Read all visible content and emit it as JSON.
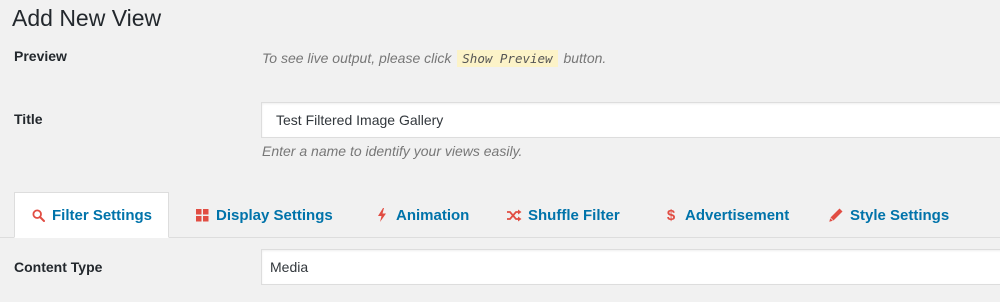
{
  "page": {
    "title": "Add New View"
  },
  "preview": {
    "label": "Preview",
    "hint_before": "To see live output, please click",
    "hint_code": "Show Preview",
    "hint_after": "button."
  },
  "title_field": {
    "label": "Title",
    "value": "Test Filtered Image Gallery",
    "hint": "Enter a name to identify your views easily."
  },
  "tabs": [
    {
      "label": "Filter Settings",
      "icon": "search-icon",
      "active": true
    },
    {
      "label": "Display Settings",
      "icon": "grid-icon",
      "active": false
    },
    {
      "label": "Animation",
      "icon": "bolt-icon",
      "active": false
    },
    {
      "label": "Shuffle Filter",
      "icon": "shuffle-icon",
      "active": false
    },
    {
      "label": "Advertisement",
      "icon": "dollar-icon",
      "active": false
    },
    {
      "label": "Style Settings",
      "icon": "pencil-icon",
      "active": false
    }
  ],
  "content_type": {
    "label": "Content Type",
    "value": "Media"
  },
  "colors": {
    "link": "#0073aa",
    "icon_red": "#e14d43",
    "highlight": "#fcf3c8"
  }
}
